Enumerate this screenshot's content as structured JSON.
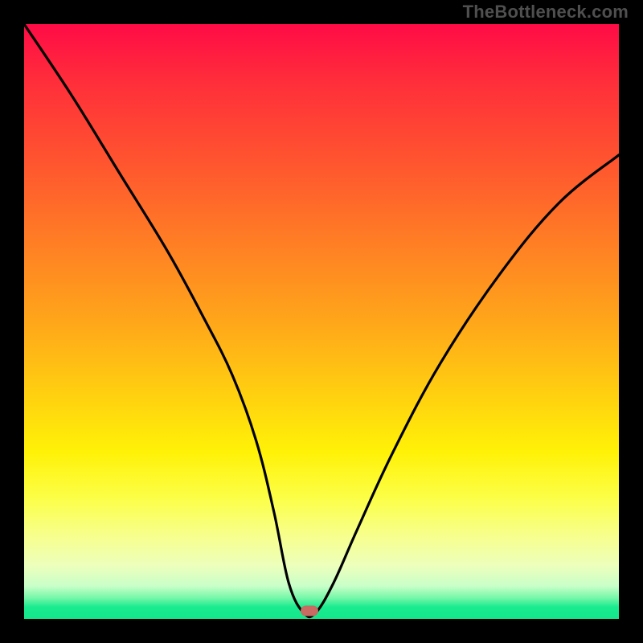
{
  "watermark": "TheBottleneck.com",
  "chart_data": {
    "type": "line",
    "title": "",
    "xlabel": "",
    "ylabel": "",
    "xlim": [
      0,
      100
    ],
    "ylim": [
      0,
      100
    ],
    "grid": false,
    "legend": false,
    "series": [
      {
        "name": "bottleneck-curve",
        "x": [
          0,
          8,
          16,
          24,
          30,
          35,
          39,
          42,
          44.5,
          47,
          49,
          52,
          56,
          62,
          70,
          80,
          90,
          100
        ],
        "y": [
          100,
          88,
          75,
          62,
          51,
          41,
          30,
          18,
          6,
          1,
          1,
          6,
          15,
          28,
          43,
          58,
          70,
          78
        ]
      }
    ],
    "marker": {
      "x": 48,
      "y": 1.3,
      "label": "optimal-point"
    },
    "gradient_stops": [
      {
        "pct": 0,
        "color": "#ff0b46"
      },
      {
        "pct": 50,
        "color": "#ffa61a"
      },
      {
        "pct": 80,
        "color": "#fcff4a"
      },
      {
        "pct": 100,
        "color": "#14e68b"
      }
    ]
  }
}
